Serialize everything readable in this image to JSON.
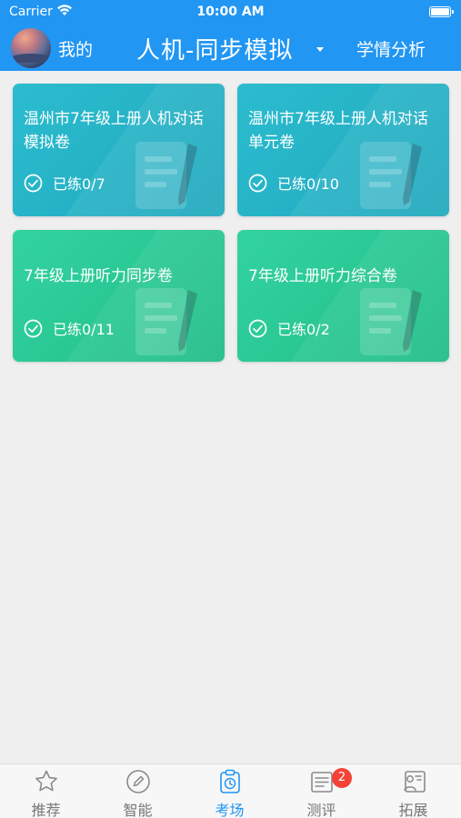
{
  "status_bar": {
    "carrier": "Carrier",
    "time": "10:00 AM"
  },
  "header": {
    "mine_label": "我的",
    "title": "人机-同步模拟",
    "analysis_label": "学情分析"
  },
  "cards": [
    {
      "title": "温州市7年级上册人机对话模拟卷",
      "progress": "已练0/7",
      "theme": "teal"
    },
    {
      "title": "温州市7年级上册人机对话单元卷",
      "progress": "已练0/10",
      "theme": "teal"
    },
    {
      "title": "7年级上册听力同步卷",
      "progress": "已练0/11",
      "theme": "green"
    },
    {
      "title": "7年级上册听力综合卷",
      "progress": "已练0/2",
      "theme": "green"
    }
  ],
  "tabs": [
    {
      "label": "推荐",
      "icon": "star-icon"
    },
    {
      "label": "智能",
      "icon": "pencil-circle-icon"
    },
    {
      "label": "考场",
      "icon": "clipboard-clock-icon",
      "active": true
    },
    {
      "label": "测评",
      "icon": "document-list-icon",
      "badge": "2"
    },
    {
      "label": "拓展",
      "icon": "person-board-icon"
    }
  ],
  "colors": {
    "primary": "#2196f3",
    "card_teal": "#26b3c6",
    "card_green": "#2ac994",
    "badge": "#f44336"
  }
}
